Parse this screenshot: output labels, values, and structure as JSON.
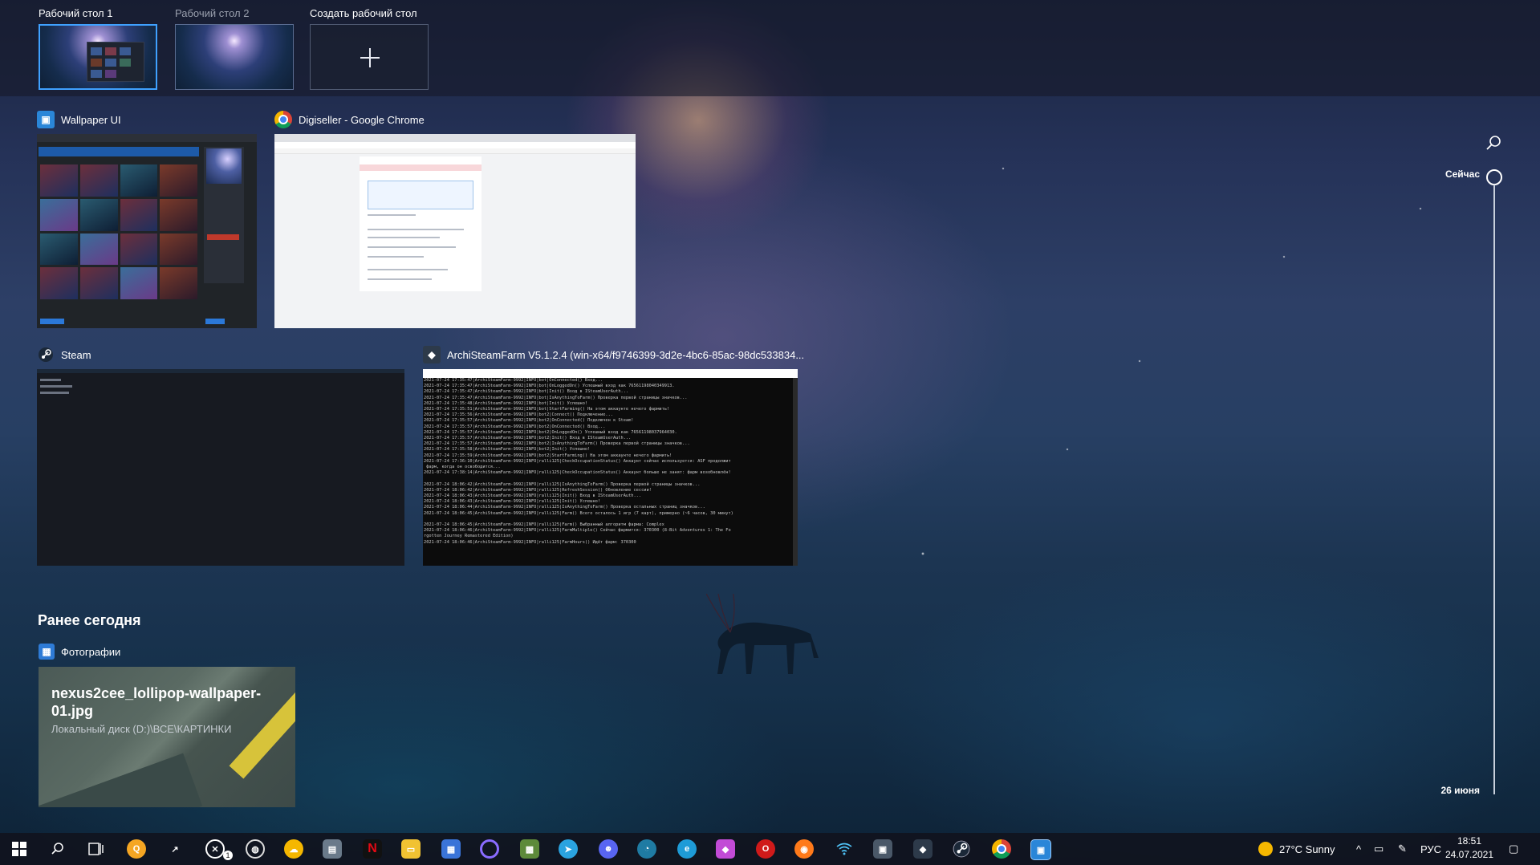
{
  "desktops": [
    {
      "label": "Рабочий стол 1",
      "active": true
    },
    {
      "label": "Рабочий стол 2",
      "active": false
    }
  ],
  "new_desktop_label": "Создать рабочий стол",
  "windows": {
    "wallpaper": {
      "title": "Wallpaper UI"
    },
    "chrome": {
      "title": "Digiseller - Google Chrome"
    },
    "steam": {
      "title": "Steam"
    },
    "asf": {
      "title": "ArchiSteamFarm V5.1.2.4 (win-x64/f9746399-3d2e-4bc6-85ac-98dc533834...",
      "log": [
        "2021-07-24 17:35:47|ArchiSteamFarm-9992|INFO|bot|OnConnected() Вход...",
        "2021-07-24 17:35:47|ArchiSteamFarm-9992|INFO|bot|OnLoggedOn() Успешный вход как 76561198040349913.",
        "2021-07-24 17:35:47|ArchiSteamFarm-9992|INFO|bot|Init() Вход в ISteamUserAuth...",
        "2021-07-24 17:35:47|ArchiSteamFarm-9992|INFO|bot|IsAnythingToFarm() Проверка первой страницы значков...",
        "2021-07-24 17:35:48|ArchiSteamFarm-9992|INFO|bot|Init() Успешно!",
        "2021-07-24 17:35:51|ArchiSteamFarm-9992|INFO|bot|StartFarming() На этом аккаунте нечего фармить!",
        "2021-07-24 17:35:56|ArchiSteamFarm-9992|INFO|bot2|Connect() Подключение...",
        "2021-07-24 17:35:57|ArchiSteamFarm-9992|INFO|bot2|OnConnected() Подключен к Steam!",
        "2021-07-24 17:35:57|ArchiSteamFarm-9992|INFO|bot2|OnConnected() Вход...",
        "2021-07-24 17:35:57|ArchiSteamFarm-9992|INFO|bot2|OnLoggedOn() Успешный вход как 76561198037964030.",
        "2021-07-24 17:35:57|ArchiSteamFarm-9992|INFO|bot2|Init() Вход в ISteamUserAuth...",
        "2021-07-24 17:35:57|ArchiSteamFarm-9992|INFO|bot2|IsAnythingToFarm() Проверка первой страницы значков...",
        "2021-07-24 17:35:58|ArchiSteamFarm-9992|INFO|bot2|Init() Успешно!",
        "2021-07-24 17:35:59|ArchiSteamFarm-9992|INFO|bot2|StartFarming() На этом аккаунте нечего фармить!",
        "2021-07-24 17:36:10|ArchiSteamFarm-9992|INFO|ralli125|CheckOccupationStatus() Аккаунт сейчас используется: ASF продолжит",
        " фарм, когда он освободится...",
        "2021-07-24 17:38:14|ArchiSteamFarm-9992|INFO|ralli125|CheckOccupationStatus() Аккаунт больше не занят: фарм возобновлён!",
        "",
        "2021-07-24 18:06:42|ArchiSteamFarm-9992|INFO|ralli125|IsAnythingToFarm() Проверка первой страницы значков...",
        "2021-07-24 18:06:42|ArchiSteamFarm-9992|INFO|ralli125|RefreshSession() Обновление сессии!",
        "2021-07-24 18:06:43|ArchiSteamFarm-9992|INFO|ralli125|Init() Вход в ISteamUserAuth...",
        "2021-07-24 18:06:43|ArchiSteamFarm-9992|INFO|ralli125|Init() Успешно!",
        "2021-07-24 18:06:44|ArchiSteamFarm-9992|INFO|ralli125|IsAnythingToFarm() Проверка остальных страниц значков...",
        "2021-07-24 18:06:45|ArchiSteamFarm-9992|INFO|ralli125|Farm() Всего осталось 1 игр (7 карт), примерно (~6 часов, 30 минут)",
        "",
        "2021-07-24 18:06:45|ArchiSteamFarm-9992|INFO|ralli125|Farm() Выбранный алгоритм фарма: Complex",
        "2021-07-24 18:06:46|ArchiSteamFarm-9992|INFO|ralli125|FarmMultiple() Сейчас фармится: 370300 (8-Bit Adventures 1: The Fo",
        "rgotten Journey Remastered Edition)",
        "2021-07-24 18:06:46|ArchiSteamFarm-9992|INFO|ralli125|FarmHours() Идёт фарм: 370300"
      ]
    }
  },
  "earlier_today": {
    "heading": "Ранее сегодня",
    "app": "Фотографии",
    "file_name": "nexus2cee_lollipop-wallpaper-01.jpg",
    "file_path": "Локальный диск (D:)\\ВСЕ\\КАРТИНКИ"
  },
  "timeline": {
    "now_label": "Сейчас",
    "date_label": "26 июня"
  },
  "taskbar": {
    "weather": "27°C  Sunny",
    "language": "РУС",
    "time": "18:51",
    "date": "24.07.2021",
    "xbox_badge": "1",
    "apps": [
      {
        "name": "start",
        "color": "transparent"
      },
      {
        "name": "search",
        "color": "transparent"
      },
      {
        "name": "task-view",
        "color": "transparent"
      },
      {
        "name": "qbittorrent",
        "color": "#f5a623"
      },
      {
        "name": "cursor-app",
        "color": "transparent"
      },
      {
        "name": "xbox",
        "color": "transparent"
      },
      {
        "name": "browser-globe",
        "color": "transparent"
      },
      {
        "name": "weather-app",
        "color": "#f5b700"
      },
      {
        "name": "calculator",
        "color": "#6a7a8a"
      },
      {
        "name": "netflix",
        "color": "#111111"
      },
      {
        "name": "file-explorer",
        "color": "#f1c232"
      },
      {
        "name": "store",
        "color": "#3a74d8"
      },
      {
        "name": "cortana",
        "color": "transparent"
      },
      {
        "name": "minecraft",
        "color": "#5d8a3a"
      },
      {
        "name": "telegram",
        "color": "#2aa3e0"
      },
      {
        "name": "discord",
        "color": "#5865f2"
      },
      {
        "name": "sticky-app",
        "color": "#1f7ba3"
      },
      {
        "name": "edge",
        "color": "#1e9bd7"
      },
      {
        "name": "gem-app",
        "color": "#c24bd6"
      },
      {
        "name": "opera",
        "color": "#d01a1a"
      },
      {
        "name": "firefox",
        "color": "#ff7a1a"
      },
      {
        "name": "wifi-app",
        "color": "transparent"
      },
      {
        "name": "windows-app",
        "color": "#4a5868"
      },
      {
        "name": "asf-app",
        "color": "#2d3a4a"
      },
      {
        "name": "steam",
        "color": "transparent"
      },
      {
        "name": "chrome",
        "color": "transparent"
      },
      {
        "name": "wallpaper-engine",
        "color": "#2a86d8"
      }
    ]
  }
}
